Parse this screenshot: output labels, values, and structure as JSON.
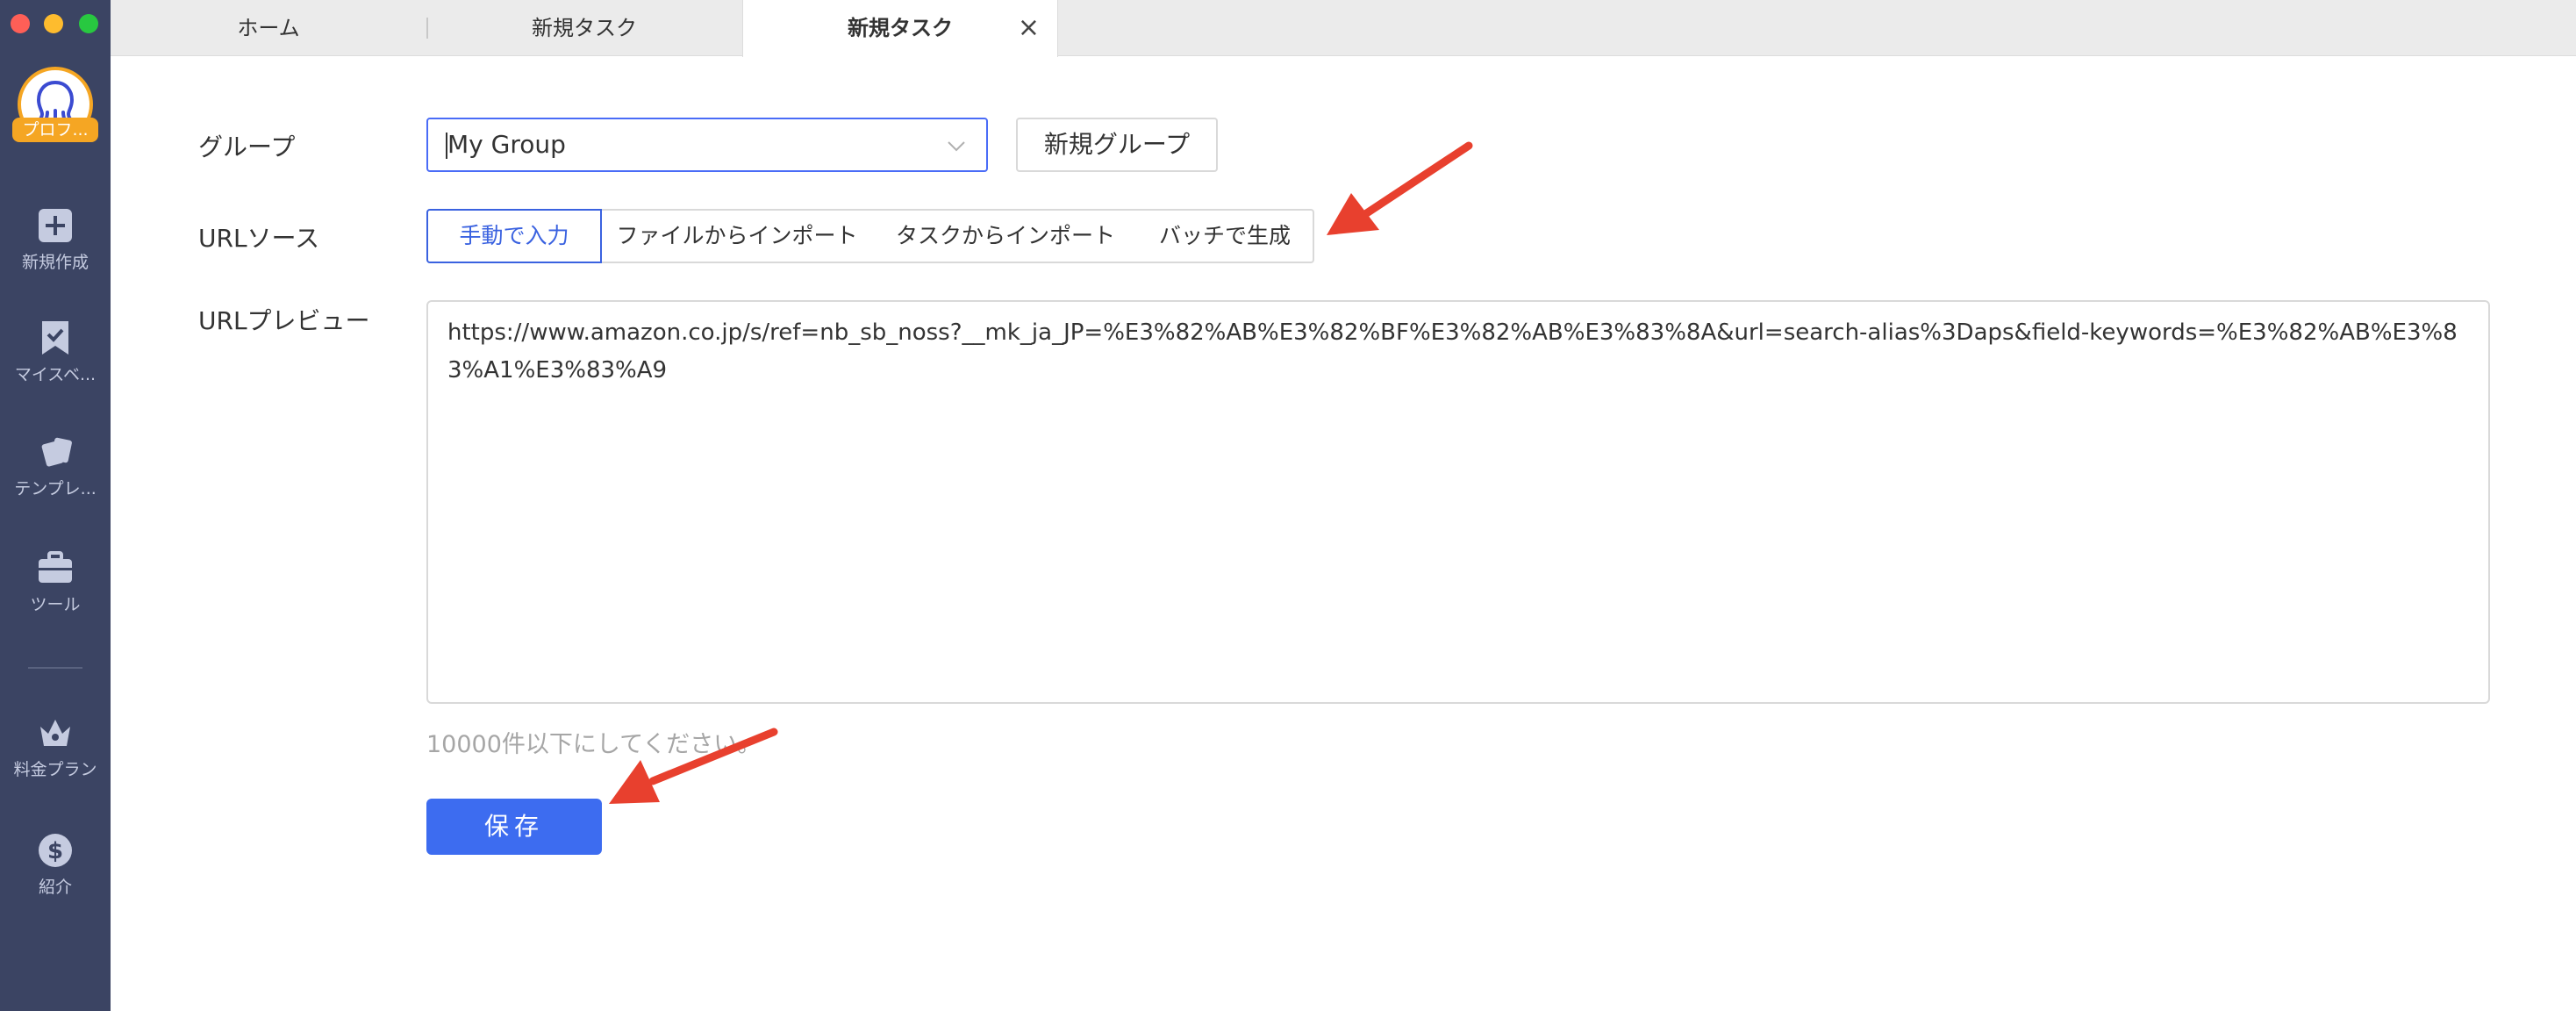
{
  "sidebar": {
    "profile_tag": "プロフ...",
    "items": [
      {
        "label": "新規作成",
        "icon": "plus-square-icon"
      },
      {
        "label": "マイスベ...",
        "icon": "bookmark-icon"
      },
      {
        "label": "テンプレ...",
        "icon": "template-icon"
      },
      {
        "label": "ツール",
        "icon": "toolbox-icon"
      },
      {
        "label": "料金プラン",
        "icon": "crown-icon"
      },
      {
        "label": "紹介",
        "icon": "dollar-icon"
      }
    ]
  },
  "tabs": [
    {
      "label": "ホーム"
    },
    {
      "label": "新規タスク"
    },
    {
      "label": "新規タスク",
      "active": true
    }
  ],
  "form": {
    "group_label": "グループ",
    "group_value": "My Group",
    "new_group_button": "新規グループ",
    "url_source_label": "URLソース",
    "url_source_options": [
      "手動で入力",
      "ファイルからインポート",
      "タスクからインポート",
      "バッチで生成"
    ],
    "url_source_selected": "手動で入力",
    "url_preview_label": "URLプレビュー",
    "url_preview_value": "https://www.amazon.co.jp/s/ref=nb_sb_noss?__mk_ja_JP=%E3%82%AB%E3%82%BF%E3%82%AB%E3%83%8A&url=search-alias%3Daps&field-keywords=%E3%82%AB%E3%83%A1%E3%83%A9",
    "hint": "10000件以下にしてください。",
    "save_button": "保存"
  },
  "colors": {
    "sidebar_bg": "#3b4463",
    "accent": "#3d6cf0",
    "annotation_arrow": "#e8402e"
  }
}
